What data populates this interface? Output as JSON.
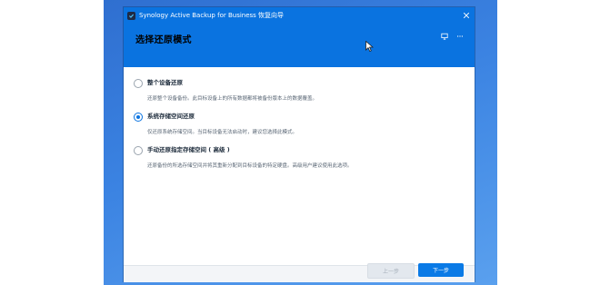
{
  "window": {
    "title": "Synology Active Backup for Business 恢复向导",
    "icon": "app-logo-icon",
    "close_icon": "close-icon"
  },
  "header": {
    "title": "选择还原模式",
    "icons": [
      "monitor-icon",
      "more-icon"
    ]
  },
  "options": [
    {
      "label": "整个设备还原",
      "description": "还原整个设备备份。此目标设备上的所有数据都将被备份版本上的数据覆盖。",
      "selected": false
    },
    {
      "label": "系统存储空间还原",
      "description": "仅还原系统存储空间。当目标设备无法启动时，建议您选择此模式。",
      "selected": true
    },
    {
      "label": "手动还原指定存储空间 ( 高级 )",
      "description": "还原备份的所选存储空间并将其重新分配到目标设备的特定硬盘。高级用户建议使用此选项。",
      "selected": false
    }
  ],
  "footer": {
    "prev_label": "上一步",
    "next_label": "下一步"
  },
  "colors": {
    "accent": "#0a73e0",
    "desktop": "#3b83e2"
  }
}
